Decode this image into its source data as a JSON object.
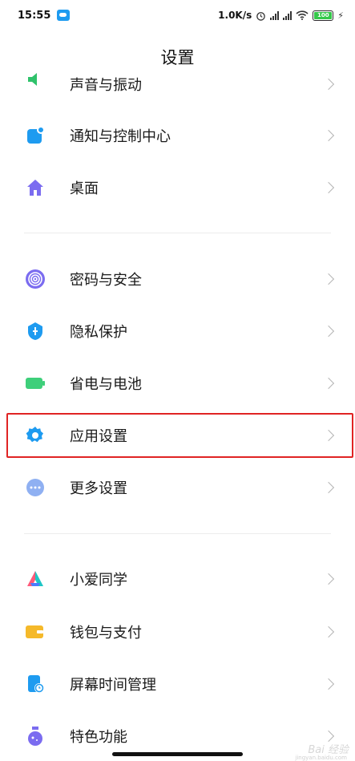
{
  "status": {
    "time": "15:55",
    "speed": "1.0K/s",
    "battery": "100"
  },
  "header": {
    "title": "设置"
  },
  "items": [
    {
      "label": "声音与振动",
      "icon": "speaker-icon"
    },
    {
      "label": "通知与控制中心",
      "icon": "notification-icon"
    },
    {
      "label": "桌面",
      "icon": "home-icon"
    },
    {
      "label": "密码与安全",
      "icon": "fingerprint-icon"
    },
    {
      "label": "隐私保护",
      "icon": "privacy-shield-icon"
    },
    {
      "label": "省电与电池",
      "icon": "battery-icon"
    },
    {
      "label": "应用设置",
      "icon": "gear-icon"
    },
    {
      "label": "更多设置",
      "icon": "more-dots-icon"
    },
    {
      "label": "小爱同学",
      "icon": "xiaoai-icon"
    },
    {
      "label": "钱包与支付",
      "icon": "wallet-icon"
    },
    {
      "label": "屏幕时间管理",
      "icon": "screen-time-icon"
    },
    {
      "label": "特色功能",
      "icon": "flask-icon"
    }
  ],
  "watermark": {
    "text": "Bai 经验",
    "sub": "jingyan.baidu.com"
  },
  "colors": {
    "accent_blue": "#1e9bf0",
    "home_purple": "#7b6cf0",
    "battery_green": "#3ecf7a",
    "more_blue": "#8fb0f2",
    "wallet_yellow": "#f5b92a",
    "highlight_red": "#e02424"
  }
}
